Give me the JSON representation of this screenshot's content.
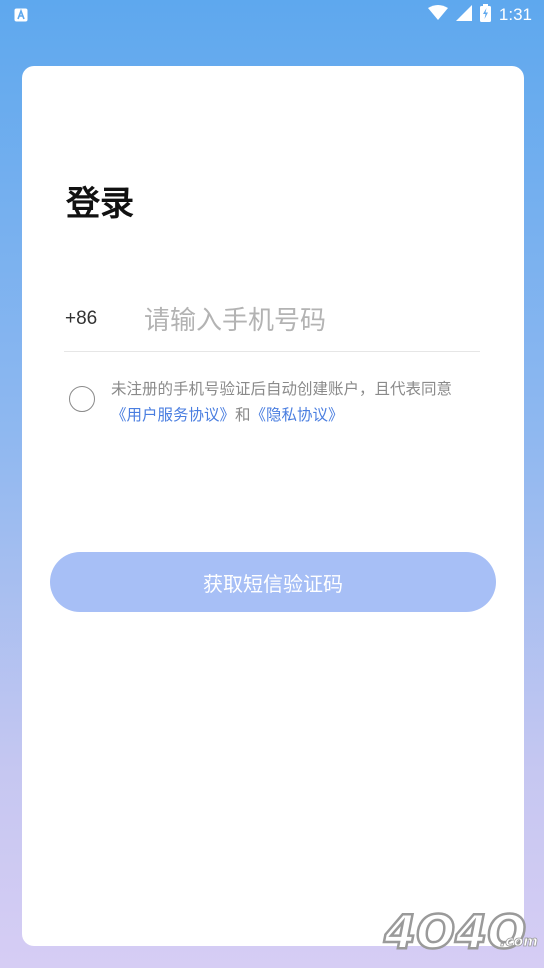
{
  "status_bar": {
    "time": "1:31",
    "icons": [
      "app-notification-icon",
      "wifi-icon",
      "signal-icon",
      "battery-charging-icon"
    ]
  },
  "login": {
    "title": "登录",
    "country_code": "+86",
    "phone_placeholder": "请输入手机号码",
    "phone_value": "",
    "agreement": {
      "text_before": "未注册的手机号验证后自动创建账户，且代表同意",
      "user_agreement_link": "《用户服务协议》",
      "conjunction": "和",
      "privacy_link": "《隐私协议》",
      "checked": false
    },
    "submit_label": "获取短信验证码"
  },
  "watermark": {
    "text": "4O4O",
    "suffix": ".com"
  },
  "colors": {
    "link": "#4a7ee0",
    "button": "#a7bff6",
    "gradient_top": "#5ea8ee",
    "gradient_bottom": "#d6cdf4"
  }
}
